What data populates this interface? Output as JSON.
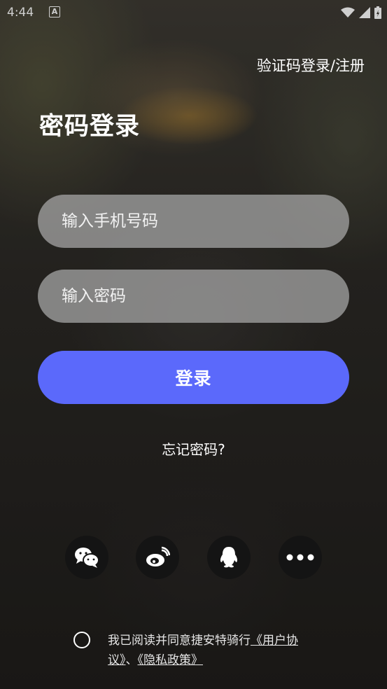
{
  "status_bar": {
    "time": "4:44",
    "notification_letter": "A",
    "icons": [
      "wifi-icon",
      "signal-icon",
      "battery-icon"
    ]
  },
  "header": {
    "switch_link": "验证码登录/注册",
    "title": "密码登录"
  },
  "form": {
    "phone_placeholder": "输入手机号码",
    "password_placeholder": "输入密码",
    "login_label": "登录",
    "forgot_label": "忘记密码?"
  },
  "social": {
    "items": [
      {
        "icon": "wechat-icon"
      },
      {
        "icon": "weibo-icon"
      },
      {
        "icon": "qq-icon"
      },
      {
        "icon": "more-icon"
      }
    ]
  },
  "agreement": {
    "prefix": "我已阅读并同意捷安特骑行",
    "user_agreement": "《用户协议》",
    "separator": "、",
    "privacy_policy": "《隐私政策》",
    "checked": false
  },
  "colors": {
    "accent": "#5b69fb",
    "field_bg": "#aaaaaa",
    "social_bg": "#141414"
  }
}
